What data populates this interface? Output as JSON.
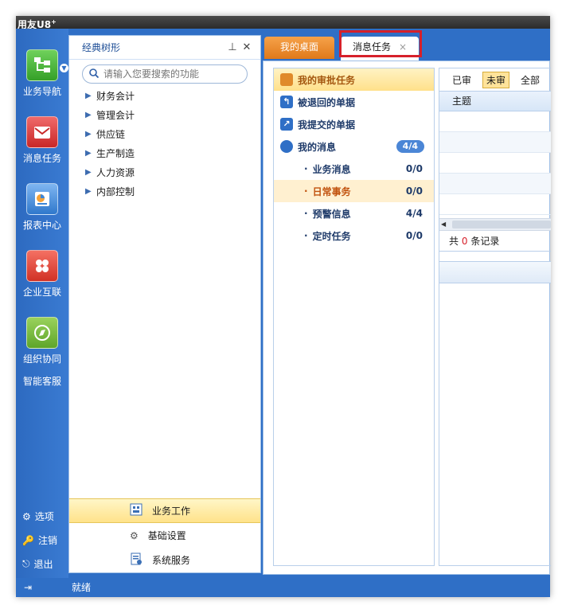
{
  "window": {
    "title": "用友U8",
    "title_sup": "+"
  },
  "rail": {
    "items": [
      {
        "label": "业务导航",
        "icon": "business-nav-icon",
        "color": "#4bb43a"
      },
      {
        "label": "消息任务",
        "icon": "message-task-icon",
        "color": "#d93a3a"
      },
      {
        "label": "报表中心",
        "icon": "report-center-icon",
        "color": "#3b86d8"
      },
      {
        "label": "企业互联",
        "icon": "enterprise-link-icon",
        "color": "#e0453a"
      },
      {
        "label": "组织协同",
        "icon": "org-collab-icon",
        "color": "#6fb83a"
      }
    ],
    "extra_label": "智能客服",
    "bottom": [
      {
        "label": "选项",
        "icon": "gear-icon"
      },
      {
        "label": "注销",
        "icon": "key-icon"
      },
      {
        "label": "退出",
        "icon": "exit-icon"
      }
    ]
  },
  "tree": {
    "title": "经典树形",
    "pin_glyph": "📌",
    "close_glyph": "✕",
    "search_placeholder": "请输入您要搜索的功能",
    "items": [
      "财务会计",
      "管理会计",
      "供应链",
      "生产制造",
      "人力资源",
      "内部控制"
    ],
    "bottom_nav": [
      {
        "label": "业务工作",
        "active": true
      },
      {
        "label": "基础设置",
        "active": false
      },
      {
        "label": "系统服务",
        "active": false
      }
    ]
  },
  "tabs": [
    {
      "label": "我的桌面"
    },
    {
      "label": "消息任务",
      "close": "×"
    }
  ],
  "side": {
    "groups": [
      {
        "label": "我的审批任务",
        "selected": true
      },
      {
        "label": "被退回的单据"
      },
      {
        "label": "我提交的单据"
      },
      {
        "label": "我的消息",
        "badge": "4/4"
      }
    ],
    "subs": [
      {
        "label": "业务消息",
        "count": "0/0",
        "selected": false
      },
      {
        "label": "日常事务",
        "count": "0/0",
        "selected": true
      },
      {
        "label": "预警信息",
        "count": "4/4",
        "selected": false
      },
      {
        "label": "定时任务",
        "count": "0/0",
        "selected": false
      }
    ]
  },
  "grid": {
    "filters": [
      {
        "label": "已审",
        "on": false
      },
      {
        "label": "未审",
        "on": true
      },
      {
        "label": "全部",
        "on": false
      }
    ],
    "column": "主题",
    "records_prefix": "共",
    "records_count": "0",
    "records_suffix": "条记录"
  },
  "status": {
    "text": "就绪"
  },
  "colors": {
    "accent": "#2f6fc6",
    "highlight": "#d6202a",
    "selected": "#ffe08a"
  }
}
